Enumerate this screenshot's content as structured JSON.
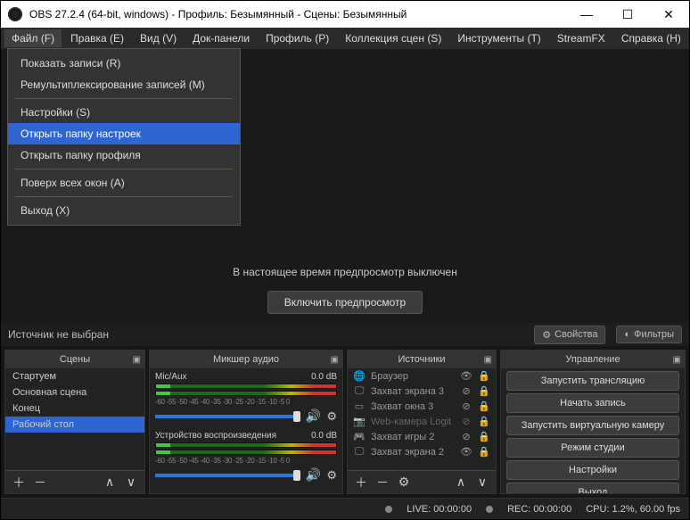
{
  "titlebar": {
    "title": "OBS 27.2.4 (64-bit, windows) - Профиль: Безымянный - Сцены: Безымянный"
  },
  "menubar": [
    "Файл (F)",
    "Правка (E)",
    "Вид (V)",
    "Док-панели",
    "Профиль (P)",
    "Коллекция сцен (S)",
    "Инструменты (T)",
    "StreamFX",
    "Справка (H)"
  ],
  "file_menu": {
    "items": [
      {
        "label": "Показать записи (R)",
        "hl": false
      },
      {
        "label": "Ремультиплексирование записей (M)",
        "hl": false
      },
      {
        "sep": true
      },
      {
        "label": "Настройки (S)",
        "hl": false
      },
      {
        "label": "Открыть папку настроек",
        "hl": true
      },
      {
        "label": "Открыть папку профиля",
        "hl": false
      },
      {
        "sep": true
      },
      {
        "label": "Поверх всех окон (A)",
        "hl": false
      },
      {
        "sep": true
      },
      {
        "label": "Выход (X)",
        "hl": false
      }
    ]
  },
  "preview": {
    "text": "В настоящее время предпросмотр выключен",
    "button": "Включить предпросмотр"
  },
  "srcrow": {
    "label": "Источник не выбран",
    "props": "Свойства",
    "filters": "Фильтры"
  },
  "panels": {
    "scenes": {
      "title": "Сцены",
      "items": [
        "Стартуем",
        "Основная сцена",
        "Конец",
        "Рабочий стол"
      ],
      "selected": 3
    },
    "mixer": {
      "title": "Микшер аудио",
      "channels": [
        {
          "name": "Mic/Aux",
          "db": "0.0 dB",
          "scale": "-60 -55 -50 -45 -40 -35 -30 -25 -20 -15 -10 -5 0"
        },
        {
          "name": "Устройство воспроизведения",
          "db": "0.0 dB",
          "scale": "-60 -55 -50 -45 -40 -35 -30 -25 -20 -15 -10 -5 0"
        }
      ]
    },
    "sources": {
      "title": "Источники",
      "items": [
        {
          "icon": "globe",
          "name": "Браузер",
          "visible": true,
          "locked": true
        },
        {
          "icon": "monitor",
          "name": "Захват экрана 3",
          "visible": false,
          "locked": true
        },
        {
          "icon": "window",
          "name": "Захват окна 3",
          "visible": false,
          "locked": true
        },
        {
          "icon": "camera",
          "name": "Web-камера Logit",
          "visible": false,
          "locked": true,
          "dim": true
        },
        {
          "icon": "game",
          "name": "Захват игры 2",
          "visible": false,
          "locked": true
        },
        {
          "icon": "monitor",
          "name": "Захват экрана 2",
          "visible": true,
          "locked": true
        }
      ]
    },
    "controls": {
      "title": "Управление",
      "buttons": [
        "Запустить трансляцию",
        "Начать запись",
        "Запустить виртуальную камеру",
        "Режим студии",
        "Настройки",
        "Выход"
      ]
    }
  },
  "statusbar": {
    "live": "LIVE: 00:00:00",
    "rec": "REC: 00:00:00",
    "cpu": "CPU: 1.2%, 60.00 fps"
  }
}
